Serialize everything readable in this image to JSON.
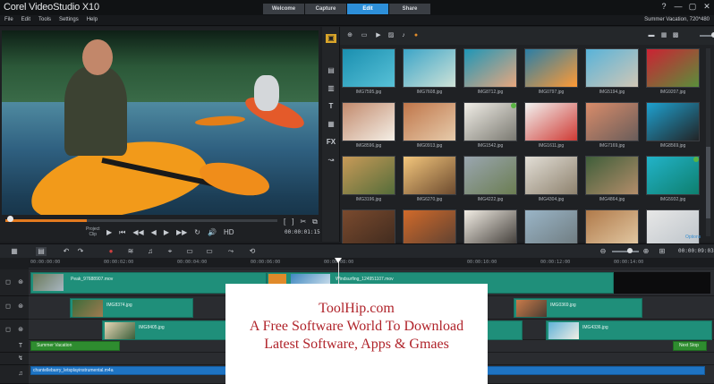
{
  "app": {
    "logo_text": "Corel VideoStudio X10",
    "workspace_tabs": [
      {
        "label": "Welcome",
        "active": false
      },
      {
        "label": "Capture",
        "active": false
      },
      {
        "label": "Edit",
        "active": true
      },
      {
        "label": "Share",
        "active": false
      }
    ],
    "window_controls": [
      "?",
      "—",
      "▢",
      "✕"
    ]
  },
  "menu": {
    "items": [
      "File",
      "Edit",
      "Tools",
      "Settings",
      "Help"
    ],
    "project_info": "Summer Vacation, 720*480"
  },
  "player": {
    "mode_labels": [
      "Project",
      "Clip"
    ],
    "timecode": "00:00:01:15",
    "transport": [
      "▶",
      "⏮",
      "◀◀",
      "◀",
      "▶",
      "▶▶",
      "↻",
      "🔊",
      "HD"
    ],
    "trim_buttons": [
      "[",
      "]",
      "✂",
      "⧉"
    ]
  },
  "library": {
    "options_label": "Options",
    "thumbnails": [
      {
        "caption": "IMG7595.jpg",
        "c1": "#1a8fb0",
        "c2": "#58c1d7",
        "check": false
      },
      {
        "caption": "IMG7608.jpg",
        "c1": "#3ca5c8",
        "c2": "#cfe2d7",
        "check": false
      },
      {
        "caption": "IMG8712.jpg",
        "c1": "#1e96b7",
        "c2": "#e8a77e",
        "check": false
      },
      {
        "caption": "IMG0797.jpg",
        "c1": "#2a7ea6",
        "c2": "#ff9a35",
        "check": false
      },
      {
        "caption": "IMG5194.jpg",
        "c1": "#58b3d9",
        "c2": "#d1c7b6",
        "check": false
      },
      {
        "caption": "IMG9207.jpg",
        "c1": "#cc2233",
        "c2": "#5a8f3b",
        "check": false
      },
      {
        "caption": "IMG8596.jpg",
        "c1": "#c28a6d",
        "c2": "#f4efe6",
        "check": false
      },
      {
        "caption": "IMG0913.jpg",
        "c1": "#c0764a",
        "c2": "#e6cbab",
        "check": false
      },
      {
        "caption": "IMG1542.jpg",
        "c1": "#f0ede6",
        "c2": "#7b7a72",
        "check": true
      },
      {
        "caption": "IMG1611.jpg",
        "c1": "#f2f3f1",
        "c2": "#cf3a34",
        "check": false
      },
      {
        "caption": "IMG7169.jpg",
        "c1": "#d98c6a",
        "c2": "#6a5d5a",
        "check": false
      },
      {
        "caption": "IMG8569.jpg",
        "c1": "#1ea1d0",
        "c2": "#222426",
        "check": false
      },
      {
        "caption": "IMG3196.jpg",
        "c1": "#c89a58",
        "c2": "#556d3a",
        "check": false
      },
      {
        "caption": "IMG6270.jpg",
        "c1": "#f3c67c",
        "c2": "#6d4b2f",
        "check": false
      },
      {
        "caption": "IMG4222.jpg",
        "c1": "#9aa6b0",
        "c2": "#6b7d52",
        "check": false
      },
      {
        "caption": "IMG4304.jpg",
        "c1": "#e2ded6",
        "c2": "#8e826e",
        "check": false
      },
      {
        "caption": "IMG4864.jpg",
        "c1": "#3f5e3a",
        "c2": "#b38d6a",
        "check": false
      },
      {
        "caption": "IMG5932.jpg",
        "c1": "#22b3c9",
        "c2": "#0e7f6e",
        "check": true
      },
      {
        "caption": "",
        "c1": "#7a4a2e",
        "c2": "#3e2a1e",
        "check": false
      },
      {
        "caption": "",
        "c1": "#d16a2a",
        "c2": "#5a4032",
        "check": false
      },
      {
        "caption": "",
        "c1": "#f2ede4",
        "c2": "#3a3632",
        "check": false
      },
      {
        "caption": "",
        "c1": "#9ab5c7",
        "c2": "#6e7a7e",
        "check": false
      },
      {
        "caption": "",
        "c1": "#b07a4a",
        "c2": "#e4cba6",
        "check": false
      },
      {
        "caption": "",
        "c1": "#e7e7e7",
        "c2": "#bcc3c9",
        "check": false
      }
    ]
  },
  "timeline": {
    "duration": "00:00:09:03",
    "ruler_labels": [
      "00:00:00:00",
      "00:00:02:00",
      "00:00:04:00",
      "00:00:06:00",
      "00:00:08:00",
      "00:00:10:00",
      "00:00:12:00",
      "00:00:14:00"
    ],
    "ruler_labels_right": [
      "00:00:12:00",
      "00:00:14:00"
    ],
    "video_clips": [
      {
        "label": "Peak_97688907.mov"
      },
      {
        "label": "Windsurfing_124951107.mov"
      }
    ],
    "overlay1_clips": [
      {
        "label": "IMG8374.jpg"
      },
      {
        "label": "IMG0369.jpg"
      }
    ],
    "overlay2_clips": [
      {
        "label": "IMG8405.jpg"
      },
      {
        "label": "IMG4336.jpg"
      }
    ],
    "title_clips": [
      {
        "label": "Summer Vacation"
      },
      {
        "label": "Next Stop"
      }
    ],
    "audio_clip": {
      "label": "chantellebarry_letsplayinstrumental.m4a"
    }
  },
  "watermark": {
    "line1": "ToolHip.com",
    "line2": "A Free Software World To Download",
    "line3": "Latest Software, Apps & Gmaes"
  }
}
